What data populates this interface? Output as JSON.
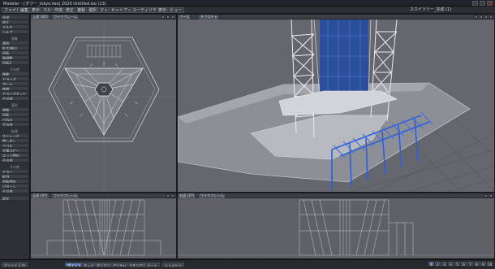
{
  "window": {
    "title": "Modeler - [タワー_tokyo.lwo] 2020 Untitled.lxo (13)"
  },
  "menubar": {
    "items": [
      "ファイル",
      "編集",
      "表示",
      "マルチ",
      "作成",
      "修正",
      "複製",
      "選択",
      "マップ",
      "セットアップ",
      "ユーティリティ",
      "表示",
      "ビュー"
    ],
    "right_label": "スカイツリー_完成  (1)"
  },
  "toolbar": {
    "groups": [
      {
        "header": "",
        "items": [
          "作成",
          "修正",
          "マルチ",
          "ヘルプ"
        ]
      },
      {
        "header": "移動",
        "items": [
          "選択",
          "拡大/縮小",
          "回転",
          "微調整",
          "回転2"
        ]
      },
      {
        "header": "その他",
        "items": [
          "移動",
          "ドラッグ",
          "ポール",
          "伸縮",
          "ドラッグネット",
          "その他"
        ]
      },
      {
        "header": "変形",
        "items": [
          "移動",
          "回転",
          "ひねる",
          "その他"
        ]
      },
      {
        "header": "拡張",
        "items": [
          "ストレッチ",
          "押し出し",
          "ベベル",
          "大量コピー",
          "エッジ押出",
          "その他"
        ]
      },
      {
        "header": "その他",
        "items": [
          "ミラー",
          "配列",
          "回転押出",
          "パターン",
          "その他"
        ]
      },
      {
        "header": "",
        "items": [
          "設定"
        ]
      }
    ]
  },
  "viewports": {
    "top_left": {
      "view": "上面 (XZ)",
      "shading": "ワイヤフレーム"
    },
    "top_right": {
      "view": "パース",
      "shading": "テクスチャ"
    },
    "bottom_left": {
      "view": "正面 (XY)",
      "shading": "ワイヤフレーム"
    },
    "bottom_right": {
      "view": "右面 (ZY)",
      "shading": "ワイヤフレーム"
    }
  },
  "statusbar": {
    "grid_label": "グリッド",
    "grid_value": "1 m",
    "modes": [
      "ポイント",
      "エッジ",
      "ポリゴン",
      "アイテム",
      "マテリアル",
      "パート"
    ],
    "symmetry": "シンメトリ",
    "layer_values": [
      "1",
      "2",
      "3",
      "4",
      "5",
      "6",
      "7",
      "8",
      "9",
      "10"
    ]
  },
  "colors": {
    "viewport_bg": "#5e6066",
    "selected_blue": "#2e5fd8",
    "wire": "#d8dce4"
  }
}
